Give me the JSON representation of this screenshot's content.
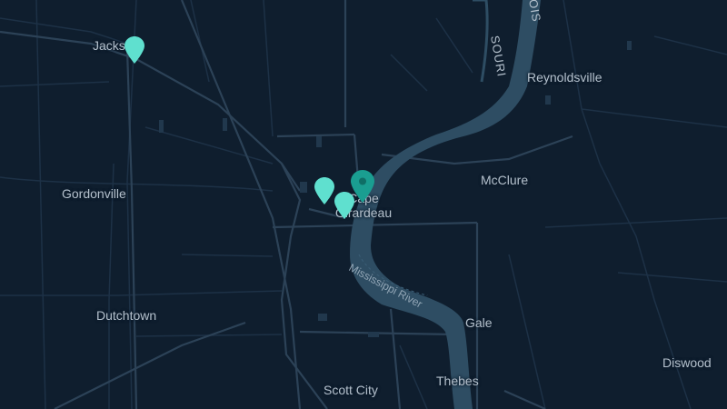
{
  "map": {
    "water_color": "#2e4d63",
    "road_color": "#2c4257",
    "minor_road_color": "#20344a",
    "background": "#0f1e2e",
    "label_color": "#b4c0cc",
    "pin_color": "#5fe0cf",
    "selected_pin_color": "#1a9e91"
  },
  "places": {
    "jackson": "Jackson",
    "gordonville": "Gordonville",
    "dutchtown": "Dutchtown",
    "cape_line1": "Cape",
    "cape_line2": "Girardeau",
    "mcclure": "McClure",
    "reynoldsville": "Reynoldsville",
    "gale": "Gale",
    "thebes": "Thebes",
    "scott_city": "Scott City",
    "diswood": "Diswood"
  },
  "water": {
    "mississippi": "Mississippi River",
    "missouri_fragment": "SOURI",
    "illinois_fragment": "OIS"
  },
  "markers": [
    {
      "name": "location-pin",
      "selected": false
    },
    {
      "name": "location-pin",
      "selected": false
    },
    {
      "name": "location-pin",
      "selected": false
    },
    {
      "name": "location-pin",
      "selected": true
    }
  ]
}
